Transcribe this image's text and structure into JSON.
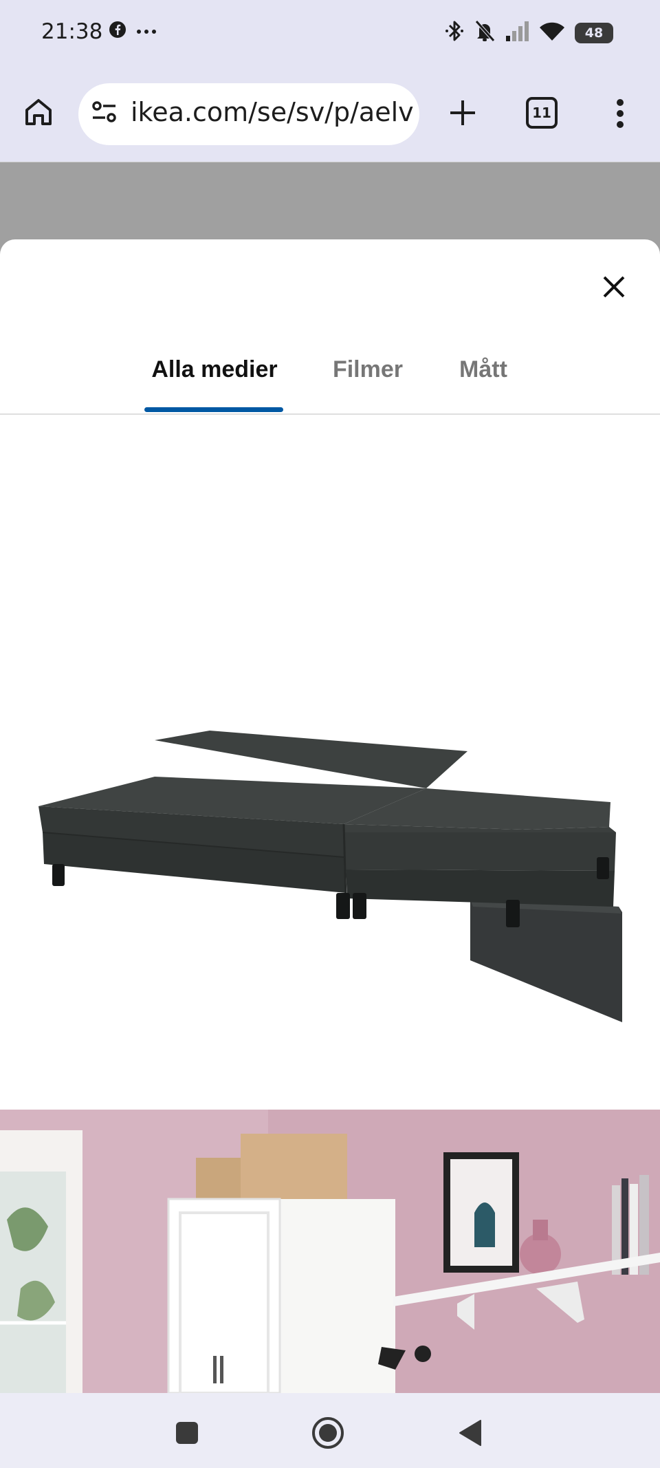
{
  "status_bar": {
    "time": "21:38",
    "left_icons": [
      "facebook-icon",
      "more-dots-icon"
    ],
    "right_icons": [
      "bluetooth-icon",
      "bell-off-icon",
      "signal-icon",
      "wifi-icon"
    ],
    "battery_level": "48"
  },
  "browser": {
    "url": "ikea.com/se/sv/p/aelv",
    "tab_count": "11"
  },
  "modal": {
    "tabs": [
      {
        "label": "Alla medier",
        "active": true
      },
      {
        "label": "Filmer",
        "active": false
      },
      {
        "label": "Mått",
        "active": false
      }
    ]
  },
  "colors": {
    "tab_active_indicator": "#0058a3",
    "sofa": "#3a3e3d",
    "room_wall": "#d7b8c3"
  }
}
